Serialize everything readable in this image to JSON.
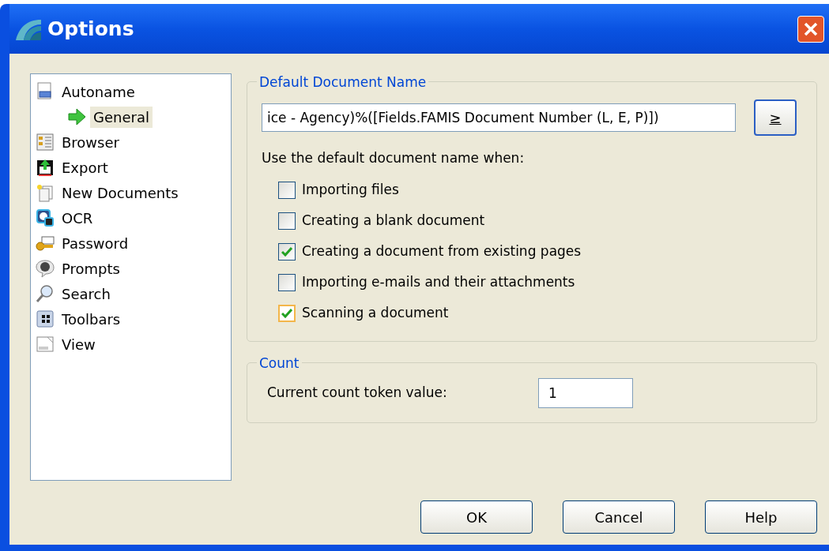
{
  "window": {
    "title": "Options"
  },
  "tree": [
    {
      "label": "Autoname",
      "selected": false,
      "children": [
        {
          "label": "General",
          "selected": true
        }
      ]
    },
    {
      "label": "Browser",
      "selected": false
    },
    {
      "label": "Export",
      "selected": false
    },
    {
      "label": "New Documents",
      "selected": false
    },
    {
      "label": "OCR",
      "selected": false
    },
    {
      "label": "Password",
      "selected": false
    },
    {
      "label": "Prompts",
      "selected": false
    },
    {
      "label": "Search",
      "selected": false
    },
    {
      "label": "Toolbars",
      "selected": false
    },
    {
      "label": "View",
      "selected": false
    }
  ],
  "default_name": {
    "legend": "Default Document Name",
    "value": "ice - Agency)%([Fields.FAMIS Document Number (L, E, P)])",
    "insert_button": "≥",
    "prompt": "Use the default document name when:",
    "options": [
      {
        "label": "Importing files",
        "checked": false
      },
      {
        "label": "Creating a blank document",
        "checked": false
      },
      {
        "label": "Creating a document from existing pages",
        "checked": true
      },
      {
        "label": "Importing e-mails and their attachments",
        "checked": false
      },
      {
        "label": "Scanning a document",
        "checked": true,
        "focused": true
      }
    ]
  },
  "count": {
    "legend": "Count",
    "label": "Current count token value:",
    "value": "1"
  },
  "buttons": [
    "OK",
    "Cancel",
    "Help"
  ]
}
